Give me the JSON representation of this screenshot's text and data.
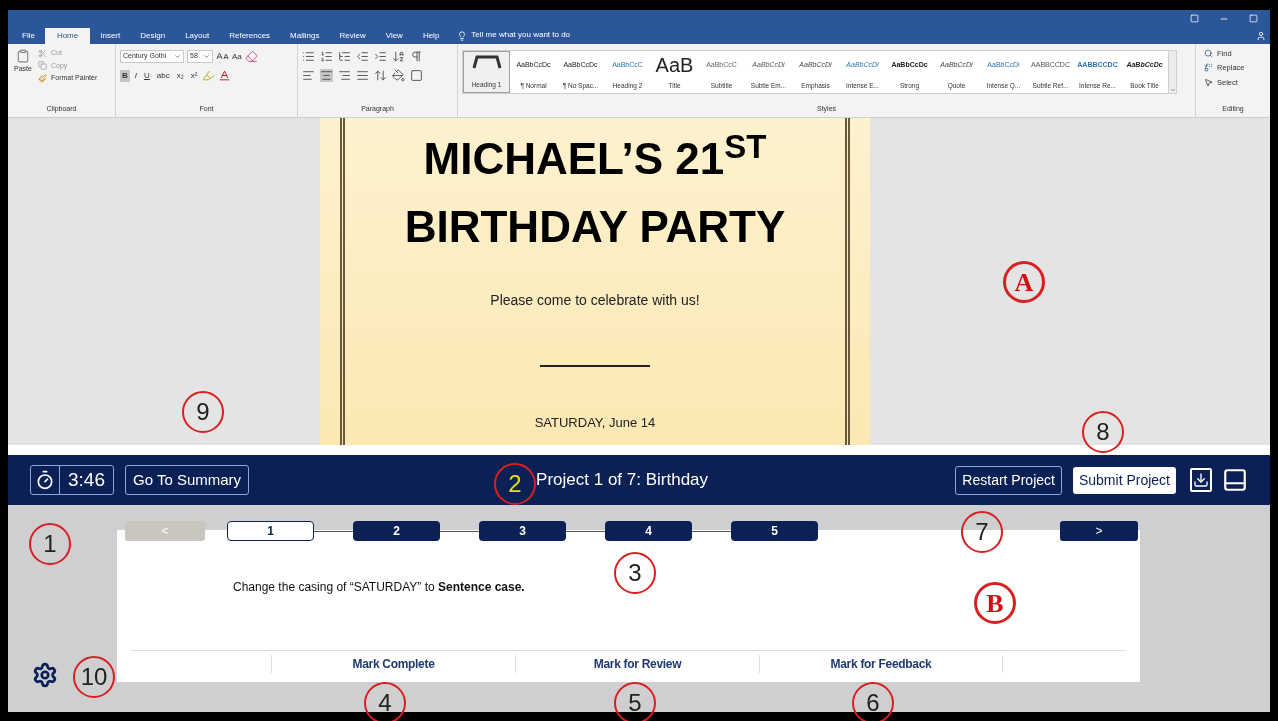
{
  "ribbon": {
    "tabs": [
      {
        "label": "File",
        "selected": false
      },
      {
        "label": "Home",
        "selected": true
      },
      {
        "label": "Insert",
        "selected": false
      },
      {
        "label": "Design",
        "selected": false
      },
      {
        "label": "Layout",
        "selected": false
      },
      {
        "label": "References",
        "selected": false
      },
      {
        "label": "Mailings",
        "selected": false
      },
      {
        "label": "Review",
        "selected": false
      },
      {
        "label": "View",
        "selected": false
      },
      {
        "label": "Help",
        "selected": false
      }
    ],
    "tell_me": "Tell me what you want to do",
    "clipboard": {
      "paste": "Paste",
      "cut": "Cut",
      "copy": "Copy",
      "format_painter": "Format Painter",
      "label": "Clipboard"
    },
    "font": {
      "name": "Century Gothi",
      "size": "58",
      "change_case": "Aa",
      "format_buttons": [
        {
          "label": "B",
          "selected": true
        },
        {
          "label": "I",
          "selected": false
        },
        {
          "label": "U",
          "selected": false
        },
        {
          "label": "abc",
          "selected": false
        },
        {
          "label": "x₂",
          "selected": false
        },
        {
          "label": "x²",
          "selected": false
        }
      ],
      "label": "Font"
    },
    "paragraph": {
      "alignments": [
        {
          "selected": false
        },
        {
          "selected": true
        },
        {
          "selected": false
        },
        {
          "selected": false
        }
      ],
      "label": "Paragraph"
    },
    "styles": {
      "items": [
        {
          "kind": "glyph",
          "name": "Heading 1",
          "selected": true
        },
        {
          "kind": "text",
          "preview": "AaBbCcDc",
          "name": "¶ Normal",
          "selected": false
        },
        {
          "kind": "text",
          "preview": "AaBbCcDc",
          "name": "¶ No Spac...",
          "selected": false
        },
        {
          "kind": "text",
          "preview": "AaBbCcC",
          "name": "Heading 2",
          "selected": false
        },
        {
          "kind": "big",
          "preview": "AaB",
          "name": "Title",
          "selected": false
        },
        {
          "kind": "text",
          "preview": "AaBbCcC",
          "name": "Subtitle",
          "selected": false
        },
        {
          "kind": "text",
          "preview": "AaBbCcDi",
          "name": "Subtle Em...",
          "selected": false
        },
        {
          "kind": "text",
          "preview": "AaBbCcDi",
          "name": "Emphasis",
          "selected": false
        },
        {
          "kind": "text",
          "preview": "AaBbCcDi",
          "name": "Intense E...",
          "selected": false
        },
        {
          "kind": "text",
          "preview": "AaBbCcDc",
          "name": "Strong",
          "selected": false
        },
        {
          "kind": "text",
          "preview": "AaBbCcDi",
          "name": "Quote",
          "selected": false
        },
        {
          "kind": "text",
          "preview": "AaBbCcDi",
          "name": "Intense Q...",
          "selected": false
        },
        {
          "kind": "text",
          "preview": "AABBCCDC",
          "name": "Subtle Ref...",
          "selected": false
        },
        {
          "kind": "text",
          "preview": "AABBCCDC",
          "name": "Intense Re...",
          "selected": false
        },
        {
          "kind": "text",
          "preview": "AaBbCcDc",
          "name": "Book Title",
          "selected": false
        }
      ],
      "label": "Styles"
    },
    "editing": {
      "find": "Find",
      "replace": "Replace",
      "select": "Select",
      "label": "Editing"
    }
  },
  "document": {
    "title": "MICHAEL’S 21$^{ST}$",
    "title_line2": "BIRTHDAY PARTY",
    "invitation": "Please come to celebrate with us!",
    "date": "SATURDAY, June 14"
  },
  "exam_bar": {
    "timer": "3:46",
    "summary_button": "Go To Summary",
    "project_title": "Project 1 of 7: Birthday",
    "restart_button": "Restart Project",
    "submit_button": "Submit Project"
  },
  "tasks": {
    "previous": {
      "label": "<",
      "disabled": true
    },
    "steps": [
      {
        "label": "1",
        "selected": true
      },
      {
        "label": "2",
        "selected": false
      },
      {
        "label": "3",
        "selected": false
      },
      {
        "label": "4",
        "selected": false
      },
      {
        "label": "5",
        "selected": false
      }
    ],
    "next": {
      "label": ">",
      "disabled": false
    },
    "instruction": "Change the casing of “SATURDAY” to **Sentence case.**",
    "actions": [
      "Mark Complete",
      "Mark for Review",
      "Mark for Feedback"
    ]
  },
  "annotations": [
    {
      "label": "A",
      "kind": "letter",
      "color": "#d01010"
    },
    {
      "label": "9",
      "kind": "number",
      "color": "#222222"
    },
    {
      "label": "8",
      "kind": "number",
      "color": "#222222"
    },
    {
      "label": "2",
      "kind": "number",
      "color": "#e8e000"
    },
    {
      "label": "1",
      "kind": "number",
      "color": "#222222"
    },
    {
      "label": "7",
      "kind": "number",
      "color": "#222222"
    },
    {
      "label": "3",
      "kind": "number",
      "color": "#222222"
    },
    {
      "label": "B",
      "kind": "letter",
      "color": "#d01010"
    },
    {
      "label": "10",
      "kind": "number",
      "color": "#222222"
    },
    {
      "label": "4",
      "kind": "number",
      "color": "#222222"
    },
    {
      "label": "5",
      "kind": "number",
      "color": "#222222"
    },
    {
      "label": "6",
      "kind": "number",
      "color": "#222222"
    }
  ]
}
